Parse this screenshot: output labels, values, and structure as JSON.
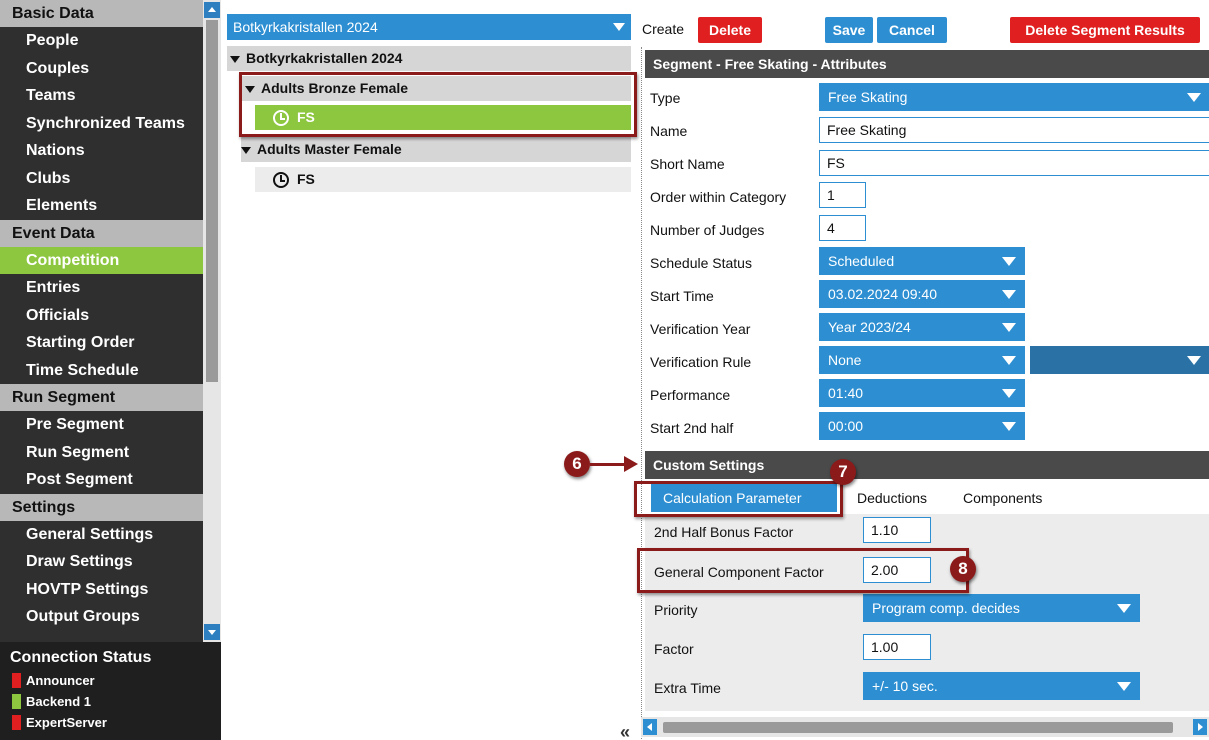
{
  "sidebar": {
    "groups": [
      {
        "head": "Basic Data",
        "items": [
          "People",
          "Couples",
          "Teams",
          "Synchronized Teams",
          "Nations",
          "Clubs",
          "Elements"
        ]
      },
      {
        "head": "Event Data",
        "items": [
          "Competition",
          "Entries",
          "Officials",
          "Starting Order",
          "Time Schedule"
        ]
      },
      {
        "head": "Run Segment",
        "items": [
          "Pre Segment",
          "Run Segment",
          "Post Segment"
        ]
      },
      {
        "head": "Settings",
        "items": [
          "General Settings",
          "Draw Settings",
          "HOVTP Settings",
          "Output Groups"
        ]
      }
    ],
    "active_item": "Competition"
  },
  "connection": {
    "title": "Connection Status",
    "items": [
      {
        "label": "Announcer",
        "color": "#e02020"
      },
      {
        "label": "Backend 1",
        "color": "#8dc63f"
      },
      {
        "label": "ExpertServer",
        "color": "#e02020"
      }
    ]
  },
  "tree": {
    "selector": "Botkyrkakristallen 2024",
    "root": "Botkyrkakristallen 2024",
    "categories": [
      {
        "name": "Adults Bronze Female",
        "segment": "FS"
      },
      {
        "name": "Adults Master Female",
        "segment": "FS"
      }
    ]
  },
  "toolbar": {
    "create": "Create",
    "delete": "Delete",
    "save": "Save",
    "cancel": "Cancel",
    "delete_results": "Delete Segment Results"
  },
  "form": {
    "section_title": "Segment - Free Skating - Attributes",
    "type_label": "Type",
    "type_value": "Free Skating",
    "name_label": "Name",
    "name_value": "Free Skating",
    "short_name_label": "Short Name",
    "short_name_value": "FS",
    "order_label": "Order within Category",
    "order_value": "1",
    "judges_label": "Number of Judges",
    "judges_value": "4",
    "schedule_label": "Schedule Status",
    "schedule_value": "Scheduled",
    "start_label": "Start Time",
    "start_value": "03.02.2024 09:40",
    "verif_year_label": "Verification Year",
    "verif_year_value": "Year 2023/24",
    "verif_rule_label": "Verification Rule",
    "verif_rule_value": "None",
    "performance_label": "Performance",
    "performance_value": "01:40",
    "second_half_label": "Start 2nd half",
    "second_half_value": "00:00"
  },
  "custom": {
    "title": "Custom Settings",
    "tabs": [
      "Calculation Parameter",
      "Deductions",
      "Components"
    ],
    "bonus_label": "2nd Half Bonus Factor",
    "bonus_value": "1.10",
    "gcf_label": "General Component Factor",
    "gcf_value": "2.00",
    "priority_label": "Priority",
    "priority_value": "Program comp. decides",
    "factor_label": "Factor",
    "factor_value": "1.00",
    "extra_label": "Extra Time",
    "extra_value": "+/- 10 sec."
  },
  "annotations": {
    "six": "6",
    "seven": "7",
    "eight": "8"
  },
  "colors": {
    "accent_blue": "#2d8fd2",
    "active_green": "#8dc63f",
    "danger_red": "#e02020",
    "annotation": "#8b1a1a"
  }
}
